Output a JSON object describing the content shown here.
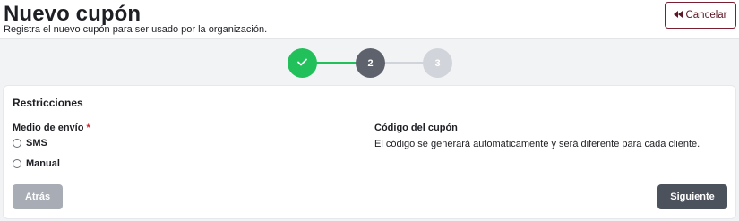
{
  "header": {
    "title": "Nuevo cupón",
    "subtitle": "Registra el nuevo cupón para ser usado por la organización.",
    "cancel_label": "Cancelar",
    "cancel_icon": "double-chevron-left-icon"
  },
  "stepper": {
    "steps": [
      {
        "label": "",
        "state": "completed",
        "icon": "check-icon"
      },
      {
        "label": "2",
        "state": "current"
      },
      {
        "label": "3",
        "state": "pending"
      }
    ]
  },
  "form": {
    "section_title": "Restricciones",
    "delivery": {
      "label": "Medio de envío",
      "required_mark": "*",
      "options": [
        {
          "label": "SMS",
          "selected": false
        },
        {
          "label": "Manual",
          "selected": false
        }
      ]
    },
    "coupon_code": {
      "title": "Código del cupón",
      "description": "El código se generará automáticamente y será diferente para cada cliente."
    },
    "back_label": "Atrás",
    "next_label": "Siguiente"
  },
  "colors": {
    "completed": "#22c05a",
    "current": "#5d626c",
    "pending": "#d1d4da",
    "cancel_border": "#7a1f32",
    "required": "#d0242c"
  }
}
